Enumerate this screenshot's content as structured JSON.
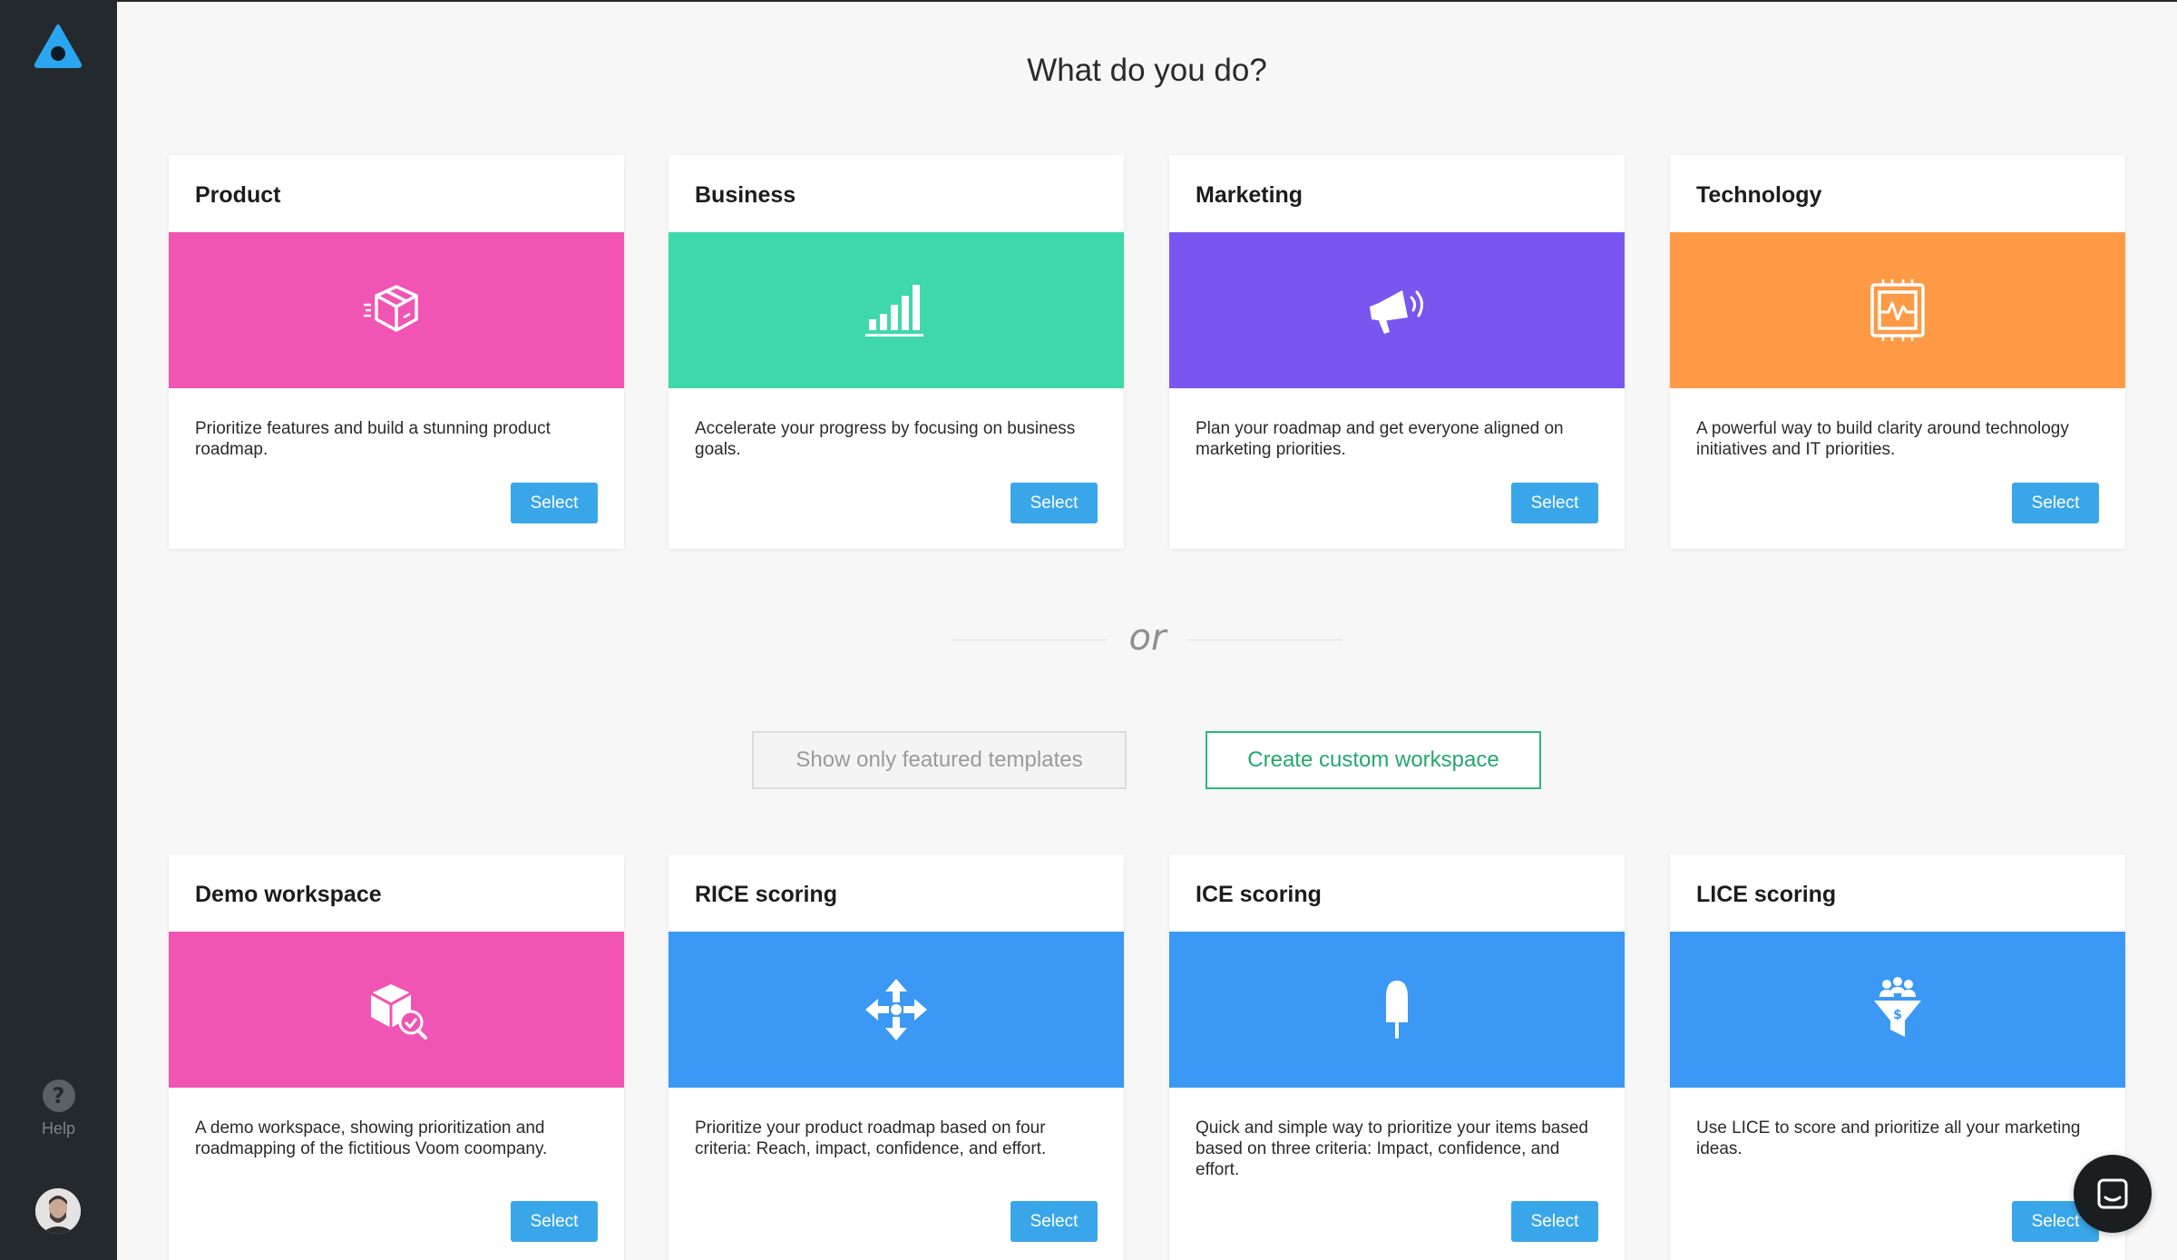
{
  "sidebar": {
    "logo_icon": "app-logo-icon",
    "help_symbol": "?",
    "help_label": "Help",
    "avatar_icon": "user-avatar"
  },
  "page": {
    "title": "What do you do?",
    "or_label": "or",
    "featured_button": "Show only featured templates",
    "custom_button": "Create custom workspace"
  },
  "colors": {
    "sidebar_bg": "#24292e",
    "select_button": "#3aa6ea",
    "custom_button_border": "#2db67c",
    "pink": "#f055b4",
    "green": "#3fd8ab",
    "purple": "#7956ef",
    "orange": "#fe9a46",
    "blue": "#3b98f4"
  },
  "categories": [
    {
      "title": "Product",
      "icon": "package-icon",
      "color": "#f055b4",
      "description": "Prioritize features and build a stunning product roadmap.",
      "select_label": "Select"
    },
    {
      "title": "Business",
      "icon": "bar-chart-icon",
      "color": "#3fd8ab",
      "description": "Accelerate your progress by focusing on business goals.",
      "select_label": "Select"
    },
    {
      "title": "Marketing",
      "icon": "megaphone-icon",
      "color": "#7956ef",
      "description": "Plan your roadmap and get everyone aligned on marketing priorities.",
      "select_label": "Select"
    },
    {
      "title": "Technology",
      "icon": "cpu-chip-icon",
      "color": "#fe9a46",
      "description": "A powerful way to build clarity around technology initiatives and IT priorities.",
      "select_label": "Select"
    }
  ],
  "templates": [
    {
      "title": "Demo workspace",
      "icon": "package-search-icon",
      "color": "#f055b4",
      "description": "A demo workspace, showing prioritization and roadmapping of the fictitious Voom coompany.",
      "select_label": "Select"
    },
    {
      "title": "RICE scoring",
      "icon": "move-arrows-icon",
      "color": "#3b98f4",
      "description": "Prioritize your product roadmap based on four criteria: Reach, impact, confidence, and effort.",
      "select_label": "Select"
    },
    {
      "title": "ICE scoring",
      "icon": "ice-pop-icon",
      "color": "#3b98f4",
      "description": "Quick and simple way to prioritize your items based based on three criteria: Impact, confidence, and effort.",
      "select_label": "Select"
    },
    {
      "title": "LICE scoring",
      "icon": "funnel-money-icon",
      "color": "#3b98f4",
      "description": "Use LICE to score and prioritize all your marketing ideas.",
      "select_label": "Select"
    }
  ],
  "chat": {
    "icon": "chat-icon"
  }
}
